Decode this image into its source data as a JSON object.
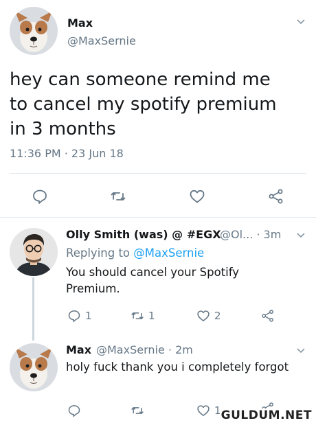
{
  "main_tweet": {
    "display_name": "Max",
    "handle": "@MaxSernie",
    "text_lines": [
      "hey can someone remind me",
      "to cancel my spotify premium",
      "in 3 months"
    ],
    "timestamp": "11:36 PM · 23 Jun 18",
    "icons": [
      "reply-icon",
      "retweet-icon",
      "like-icon",
      "share-icon",
      "chevron-down-icon"
    ]
  },
  "reply_1": {
    "display_name": "Olly Smith (was) @ #EGX",
    "handle_time": "@Ol... · 3m",
    "replying_prefix": "Replying to ",
    "replying_handle": "@MaxSernie",
    "text_lines": [
      "You should cancel your Spotify",
      "Premium."
    ],
    "reply_count": "1",
    "retweet_count": "1",
    "like_count": "2"
  },
  "reply_2": {
    "display_name": "Max",
    "handle_time": "@MaxSernie · 2m",
    "text": "holy fuck thank you i completely forgot",
    "like_count": "1"
  },
  "watermark": "GULDUM.NET",
  "colors": {
    "text": "#14171a",
    "secondary": "#657786",
    "link": "#1da1f2",
    "divider": "#e1e8ed",
    "thread_line": "#ccd6dd"
  }
}
